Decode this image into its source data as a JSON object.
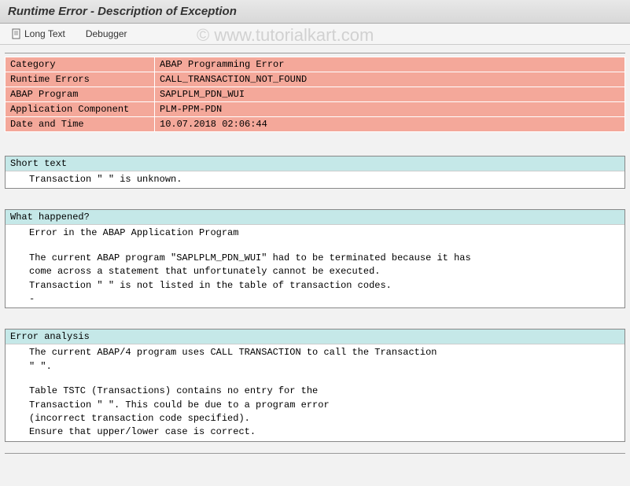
{
  "title": "Runtime Error - Description of Exception",
  "toolbar": {
    "long_text": "Long Text",
    "debugger": "Debugger"
  },
  "info": {
    "rows": [
      {
        "label": "Category",
        "value": "ABAP Programming Error"
      },
      {
        "label": "Runtime Errors",
        "value": "CALL_TRANSACTION_NOT_FOUND"
      },
      {
        "label": "ABAP Program",
        "value": "SAPLPLM_PDN_WUI"
      },
      {
        "label": "Application Component",
        "value": "PLM-PPM-PDN"
      },
      {
        "label": "Date and Time",
        "value": "10.07.2018 02:06:44"
      }
    ]
  },
  "sections": {
    "short_text": {
      "header": "Short text",
      "lines": [
        "Transaction \" \" is unknown."
      ]
    },
    "what_happened": {
      "header": "What happened?",
      "lines": [
        "Error in the ABAP Application Program",
        "",
        "The current ABAP program \"SAPLPLM_PDN_WUI\" had to be terminated because it has",
        "come across a statement that unfortunately cannot be executed.",
        "Transaction \" \" is not listed in the table of transaction codes.",
        "-"
      ]
    },
    "error_analysis": {
      "header": "Error analysis",
      "lines": [
        "The current ABAP/4 program uses CALL TRANSACTION to call the Transaction",
        "\" \".",
        "",
        "Table TSTC (Transactions) contains no entry for the",
        "Transaction \" \". This could be due to a program error",
        "(incorrect transaction code specified).",
        "Ensure that upper/lower case is correct."
      ]
    }
  },
  "watermark": "© www.tutorialkart.com"
}
